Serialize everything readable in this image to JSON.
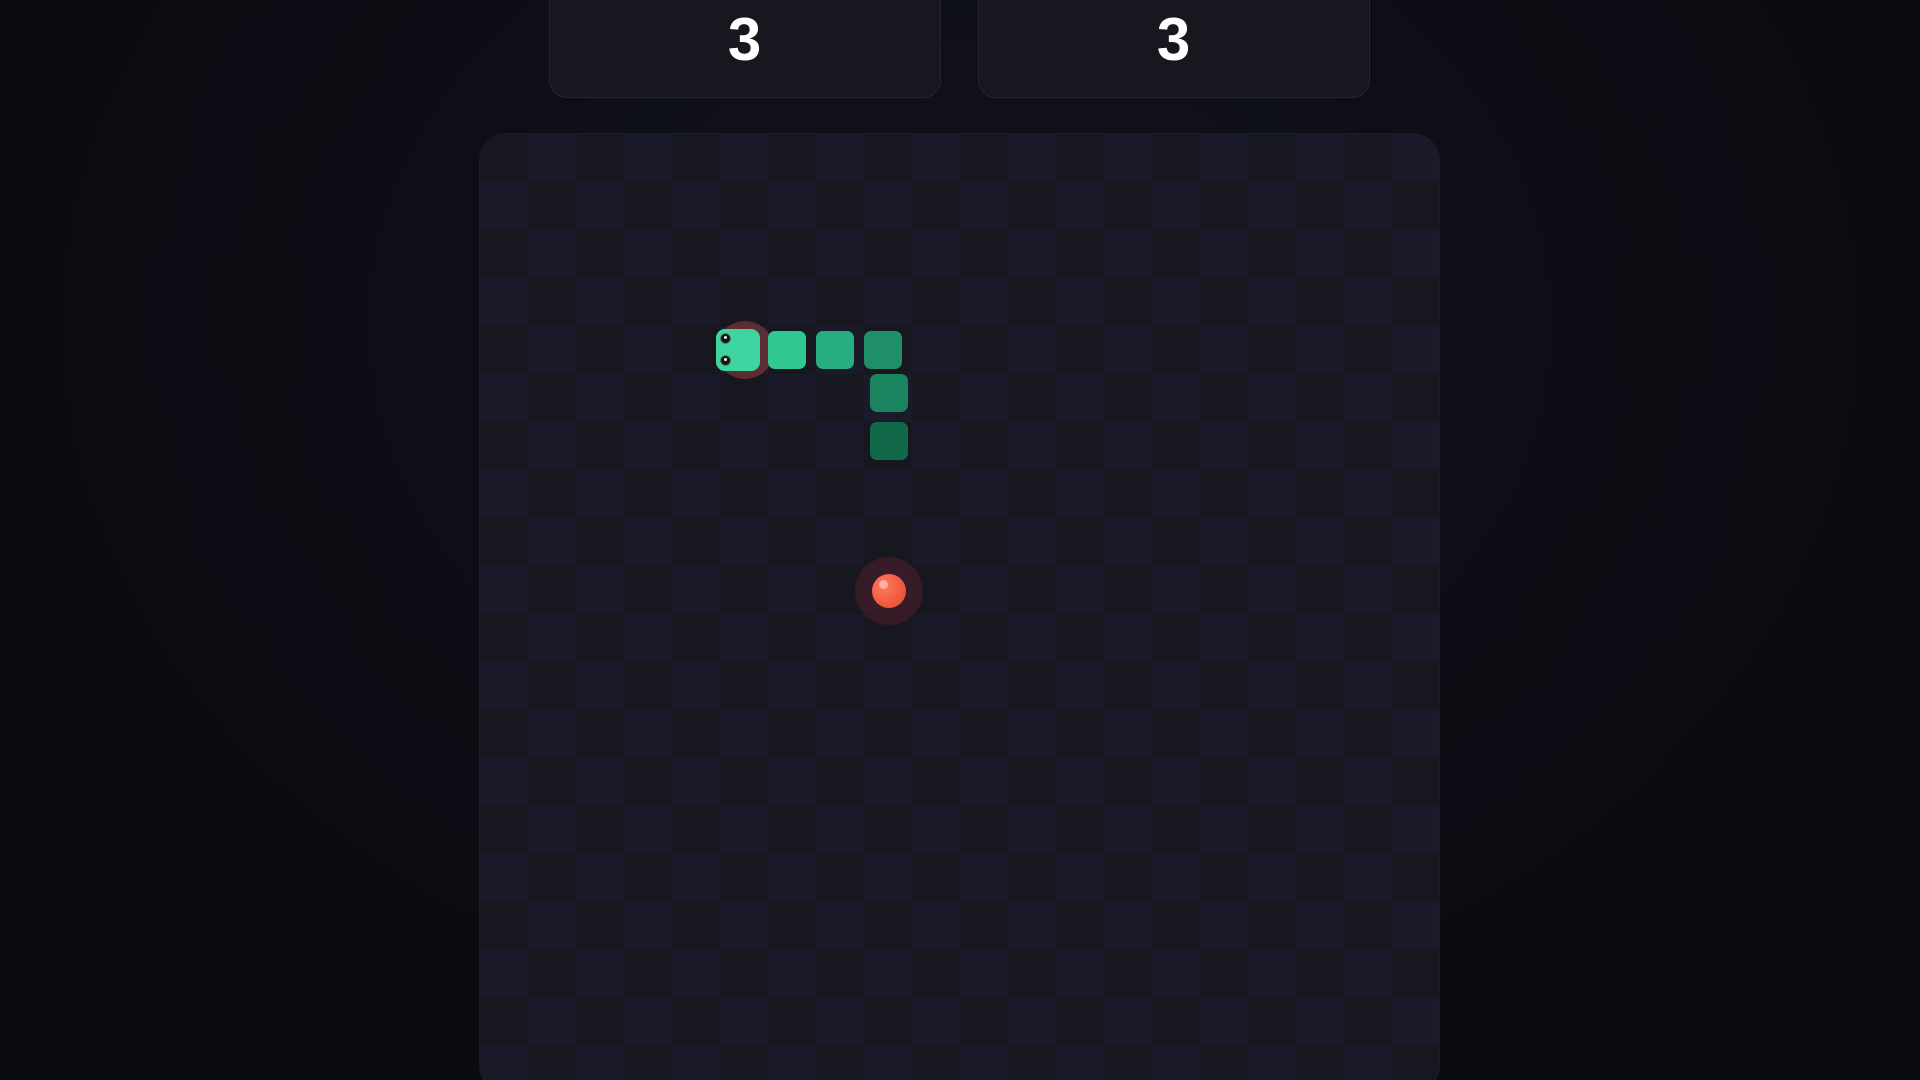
{
  "scores": {
    "left": {
      "value": "3"
    },
    "right": {
      "value": "3"
    }
  },
  "colors": {
    "background": "#0c0d14",
    "card": "#16171f",
    "board_light": "#171720",
    "board_dark": "#1a1a2a",
    "snake_head": "#3ed6a0",
    "snake_tail": "#0f5a3d",
    "food": "#f05a3e"
  },
  "snake": {
    "length": 6,
    "direction": "left"
  },
  "icons": {
    "food": "apple-orb-icon",
    "snake_eye": "eye-icon"
  }
}
